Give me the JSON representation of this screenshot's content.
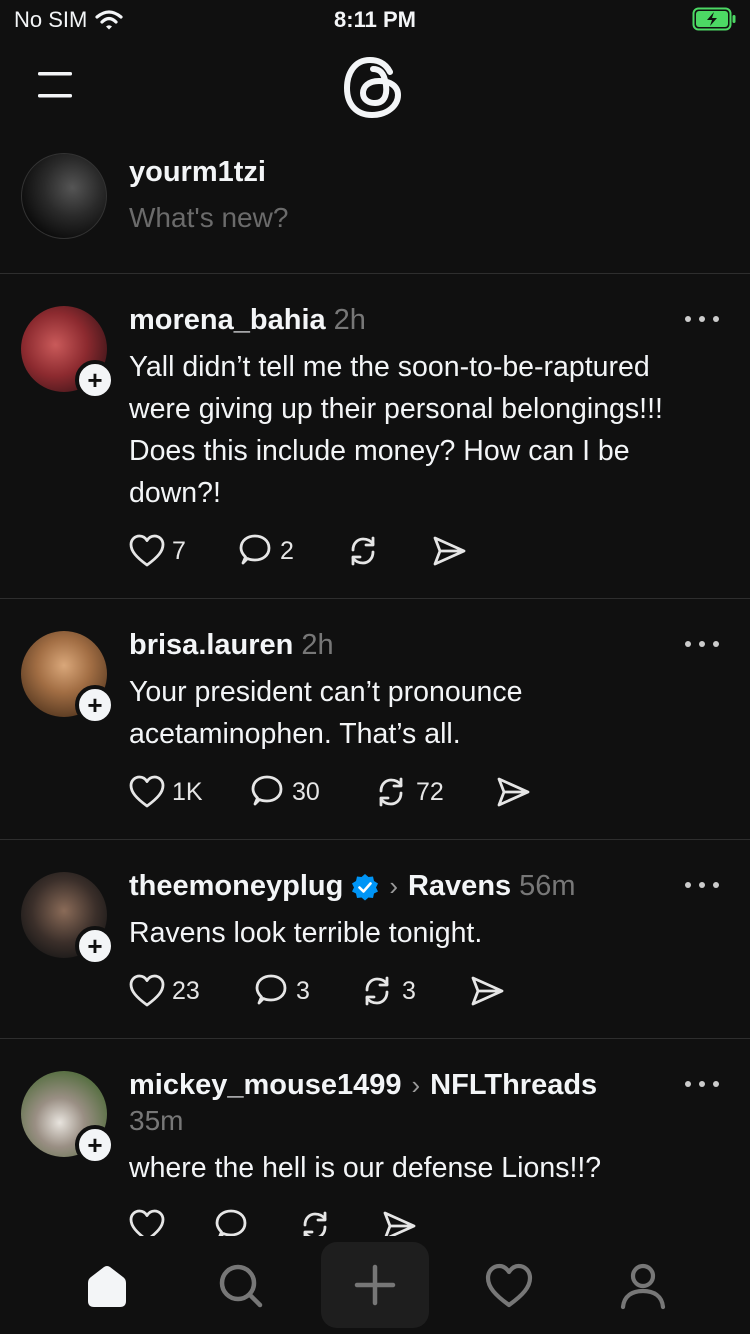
{
  "status_bar": {
    "carrier": "No SIM",
    "time": "8:11 PM"
  },
  "composer": {
    "username": "yourm1tzi",
    "placeholder": "What's new?"
  },
  "posts": [
    {
      "username": "morena_bahia",
      "time": "2h",
      "topic": "",
      "text": "Yall didn’t tell me the soon-to-be-raptured were giving up their personal belongings!!! Does this include money? How can I be down?!",
      "likes": "7",
      "replies": "2",
      "reposts": "",
      "shares": ""
    },
    {
      "username": "brisa.lauren",
      "time": "2h",
      "topic": "",
      "text": "Your president can’t pronounce acetaminophen. That’s all.",
      "likes": "1K",
      "replies": "30",
      "reposts": "72",
      "shares": ""
    },
    {
      "username": "theemoneyplug",
      "time": "56m",
      "topic": "Ravens",
      "verified": true,
      "text": "Ravens look terrible tonight.",
      "likes": "23",
      "replies": "3",
      "reposts": "3",
      "shares": ""
    },
    {
      "username": "mickey_mouse1499",
      "time": "35m",
      "topic": "NFLThreads",
      "text": "where the hell is our defense Lions!!?",
      "likes": "",
      "replies": "",
      "reposts": "",
      "shares": ""
    }
  ],
  "colors": {
    "background": "#101010",
    "text": "#f3f5f7",
    "muted": "#777777",
    "verified": "#0095f6",
    "divider": "#2e2e2e"
  },
  "tabs": [
    "home-icon",
    "search-icon",
    "compose-icon",
    "activity-icon",
    "profile-icon"
  ]
}
